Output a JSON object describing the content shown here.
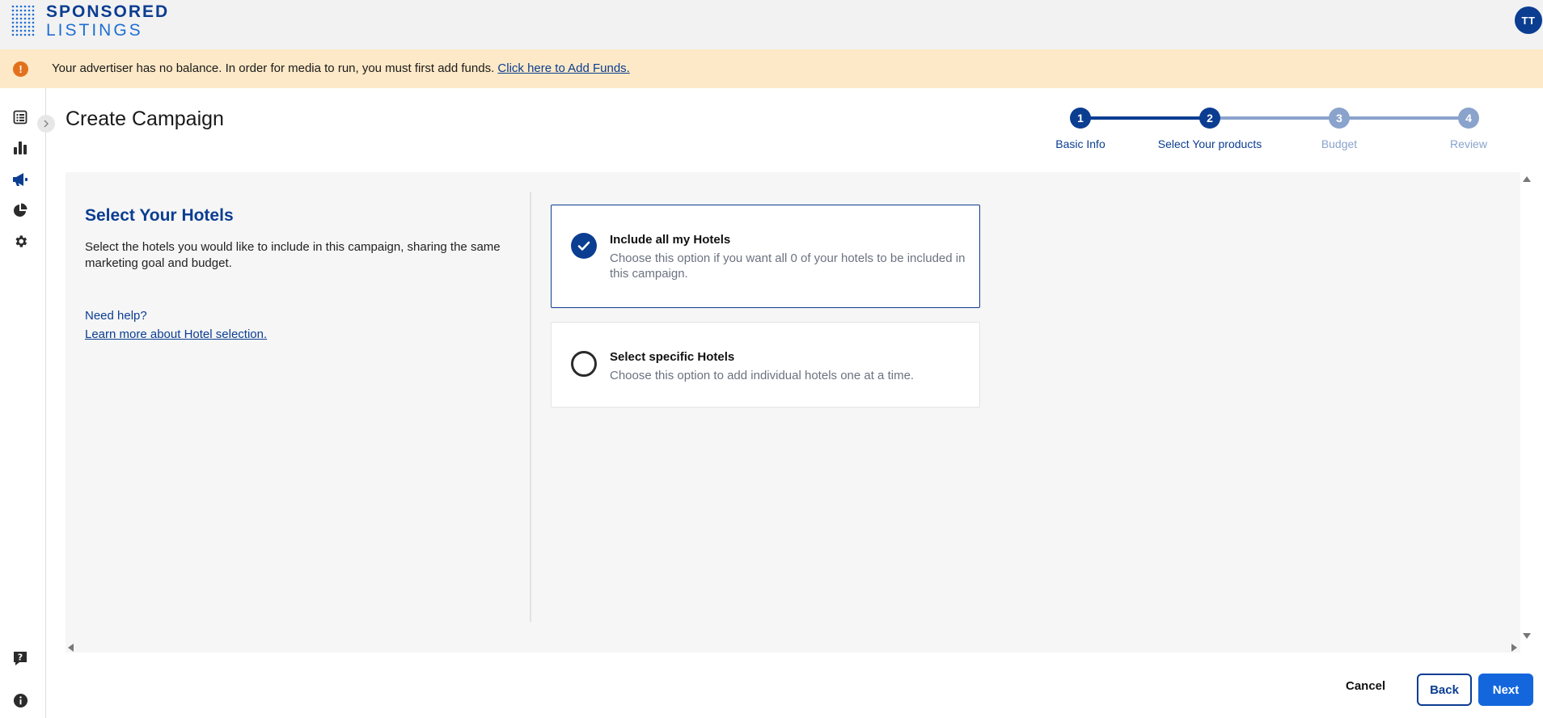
{
  "brand": {
    "line1": "SPONSORED",
    "line2": "LISTINGS"
  },
  "user": {
    "initials": "TT"
  },
  "banner": {
    "icon": "alert-icon",
    "message": "Your advertiser has no balance. In order for media to run, you must first add funds. ",
    "link": "Click here to Add Funds."
  },
  "sidebar": {
    "items": [
      {
        "icon": "campaign-list-icon"
      },
      {
        "icon": "bar-chart-icon"
      },
      {
        "icon": "megaphone-icon",
        "active": true
      },
      {
        "icon": "pie-chart-icon"
      },
      {
        "icon": "gear-icon"
      }
    ],
    "bottom": [
      {
        "icon": "help-icon"
      },
      {
        "icon": "info-icon"
      }
    ]
  },
  "page": {
    "title": "Create Campaign"
  },
  "stepper": {
    "steps": [
      {
        "number": "1",
        "label": "Basic Info",
        "state": "complete"
      },
      {
        "number": "2",
        "label": "Select Your products",
        "state": "current"
      },
      {
        "number": "3",
        "label": "Budget",
        "state": "upcoming"
      },
      {
        "number": "4",
        "label": "Review",
        "state": "upcoming"
      }
    ]
  },
  "section": {
    "title": "Select Your Hotels",
    "description": "Select the hotels you would like to include in this campaign, sharing the same marketing goal and budget.",
    "help_question": "Need help?",
    "help_link": "Learn more about Hotel selection."
  },
  "options": [
    {
      "title": "Include all my Hotels",
      "description": "Choose this option if you want all 0 of your hotels to be included in this campaign.",
      "selected": true
    },
    {
      "title": "Select specific Hotels",
      "description": "Choose this option to add individual hotels one at a time.",
      "selected": false
    }
  ],
  "footer": {
    "cancel": "Cancel",
    "back": "Back",
    "next": "Next"
  },
  "colors": {
    "primary": "#0b3d91",
    "accent": "#1466dd",
    "warning_bg": "#fde9c7",
    "warning_icon": "#e2711d",
    "step_upcoming": "#8aa3cc"
  }
}
